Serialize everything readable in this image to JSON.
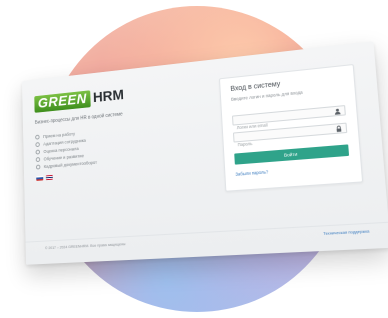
{
  "logo": {
    "brand_green": "GREEN",
    "brand_rest": "HRM"
  },
  "intro": {
    "tagline": "Бизнес-процессы для HR в одной системе"
  },
  "features": [
    "Прием на работу",
    "Адаптация сотрудника",
    "Оценка персонала",
    "Обучение и развитие",
    "Кадровый документооборот"
  ],
  "languages": [
    "ru",
    "en"
  ],
  "login": {
    "title": "Вход в систему",
    "subtitle": "Введите логин и пароль для входа",
    "username_placeholder": "Логин или email",
    "password_placeholder": "Пароль",
    "submit_label": "Войти",
    "forgot_label": "Забыли пароль?"
  },
  "footer": {
    "copyright": "© 2017 – 2024 GREENHRM. Все права защищены",
    "support_link": "Техническая поддержка"
  },
  "colors": {
    "brand_green": "#5aa832",
    "button": "#2fa38a",
    "link": "#3a7bbf",
    "blob_warm": "#ee8f86",
    "blob_cool": "#a9c3ef"
  }
}
